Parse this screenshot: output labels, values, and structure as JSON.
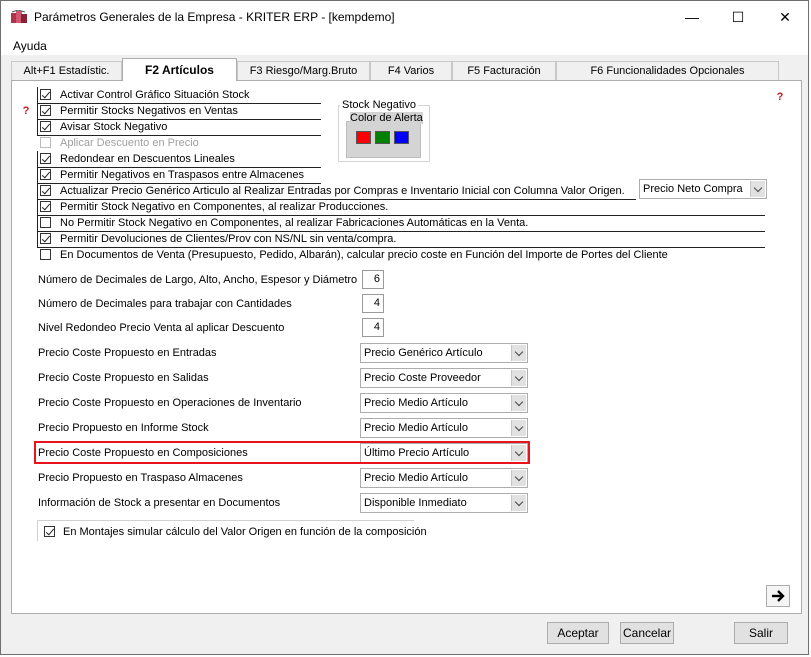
{
  "window": {
    "title": "Parámetros Generales de la Empresa - KRITER ERP - [kempdemo]",
    "minimize_glyph": "—",
    "maximize_glyph": "☐",
    "close_glyph": "✕"
  },
  "menu": {
    "ayuda": "Ayuda"
  },
  "tabs": [
    {
      "label": "Alt+F1 Estadístic."
    },
    {
      "label": "F2 Artículos"
    },
    {
      "label": "F3 Riesgo/Marg.Bruto"
    },
    {
      "label": "F4 Varios"
    },
    {
      "label": "F5 Facturación"
    },
    {
      "label": "F6 Funcionalidades Opcionales"
    }
  ],
  "checkboxes": [
    {
      "label": "Activar Control Gráfico Situación Stock",
      "checked": true
    },
    {
      "label": "Permitir Stocks Negativos en Ventas",
      "checked": true
    },
    {
      "label": "Avisar Stock Negativo",
      "checked": true
    },
    {
      "label": "Aplicar Descuento en Precio",
      "checked": false,
      "disabled": true
    },
    {
      "label": "Redondear en Descuentos Lineales",
      "checked": true
    },
    {
      "label": "Permitir Negativos en Traspasos entre Almacenes",
      "checked": true
    },
    {
      "label": "Actualizar Precio Genérico Articulo al Realizar Entradas por Compras e Inventario Inicial con Columna Valor Origen.",
      "checked": true
    },
    {
      "label": "Permitir Stock Negativo en Componentes, al realizar Producciones.",
      "checked": true
    },
    {
      "label": "No Permitir Stock Negativo en Componentes, al realizar Fabricaciones Automáticas en la Venta.",
      "checked": false
    },
    {
      "label": "Permitir Devoluciones de Clientes/Prov con NS/NL sin venta/compra.",
      "checked": true
    },
    {
      "label": "En Documentos de Venta (Presupuesto, Pedido, Albarán), calcular precio coste en Función del Importe de Portes del Cliente",
      "checked": false
    }
  ],
  "stock_negativo": {
    "title": "Stock Negativo",
    "subtitle": "Color de Alerta",
    "colors": [
      "#ff0000",
      "#008000",
      "#0000ff"
    ]
  },
  "precio_neto_combo": "Precio Neto Compra",
  "numeric_fields": [
    {
      "label": "Número de Decimales de Largo, Alto, Ancho, Espesor y Diámetro",
      "value": "6"
    },
    {
      "label": "Número de Decimales para trabajar con Cantidades",
      "value": "4"
    },
    {
      "label": "Nivel Redondeo Precio Venta al aplicar Descuento",
      "value": "4"
    }
  ],
  "combo_fields": [
    {
      "label": "Precio Coste Propuesto en Entradas",
      "value": "Precio Genérico Artículo"
    },
    {
      "label": "Precio Coste Propuesto en Salidas",
      "value": "Precio Coste Proveedor"
    },
    {
      "label": "Precio Coste Propuesto en Operaciones de Inventario",
      "value": "Precio Medio Artículo"
    },
    {
      "label": "Precio Propuesto en Informe Stock",
      "value": "Precio Medio Artículo"
    },
    {
      "label": "Precio Coste Propuesto en Composiciones",
      "value": "Último Precio Artículo"
    },
    {
      "label": "Precio Propuesto en Traspaso Almacenes",
      "value": "Precio Medio Artículo"
    },
    {
      "label": "Información de Stock a presentar en Documentos",
      "value": "Disponible Inmediato"
    }
  ],
  "montajes": {
    "label": "En Montajes simular cálculo del Valor Origen en función de la composición",
    "checked": true
  },
  "buttons": {
    "aceptar": "Aceptar",
    "cancelar": "Cancelar",
    "salir": "Salir",
    "next_glyph": "🡒"
  },
  "highlight_color": "#e8131c"
}
